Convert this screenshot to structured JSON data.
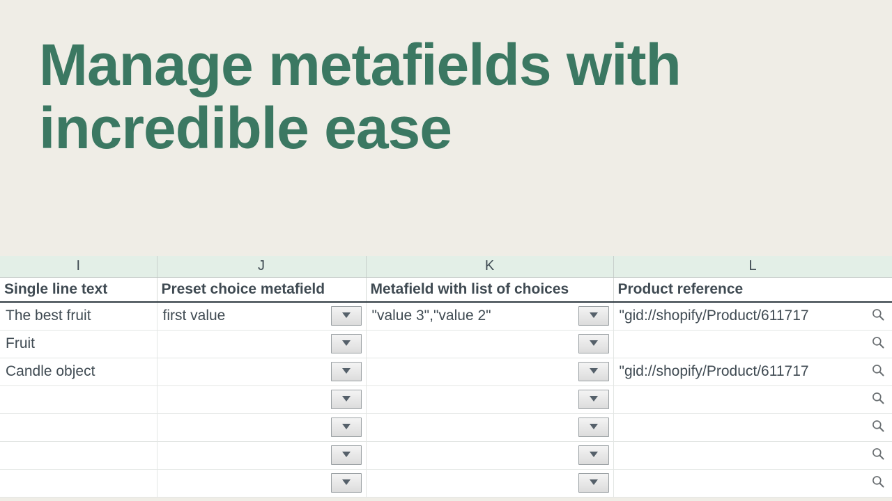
{
  "headline": "Manage metafields with incredible ease",
  "columns": {
    "letters": [
      "I",
      "J",
      "K",
      "L"
    ],
    "headers": [
      "Single line text",
      "Preset choice metafield",
      "Metafield with list of choices",
      "Product reference"
    ]
  },
  "rows": [
    {
      "text": "The best fruit",
      "preset": "first value",
      "list": "\"value 3\",\"value 2\"",
      "ref": "\"gid://shopify/Product/611717"
    },
    {
      "text": "Fruit",
      "preset": "",
      "list": "",
      "ref": ""
    },
    {
      "text": "Candle object",
      "preset": "",
      "list": "",
      "ref": "\"gid://shopify/Product/611717"
    },
    {
      "text": "",
      "preset": "",
      "list": "",
      "ref": ""
    },
    {
      "text": "",
      "preset": "",
      "list": "",
      "ref": ""
    },
    {
      "text": "",
      "preset": "",
      "list": "",
      "ref": ""
    },
    {
      "text": "",
      "preset": "",
      "list": "",
      "ref": ""
    }
  ],
  "icons": {
    "dropdown": "dropdown-icon",
    "magnifier": "magnifier-icon"
  },
  "colors": {
    "accent": "#3b7862",
    "bg": "#efede6",
    "colrow": "#e3efe7"
  }
}
